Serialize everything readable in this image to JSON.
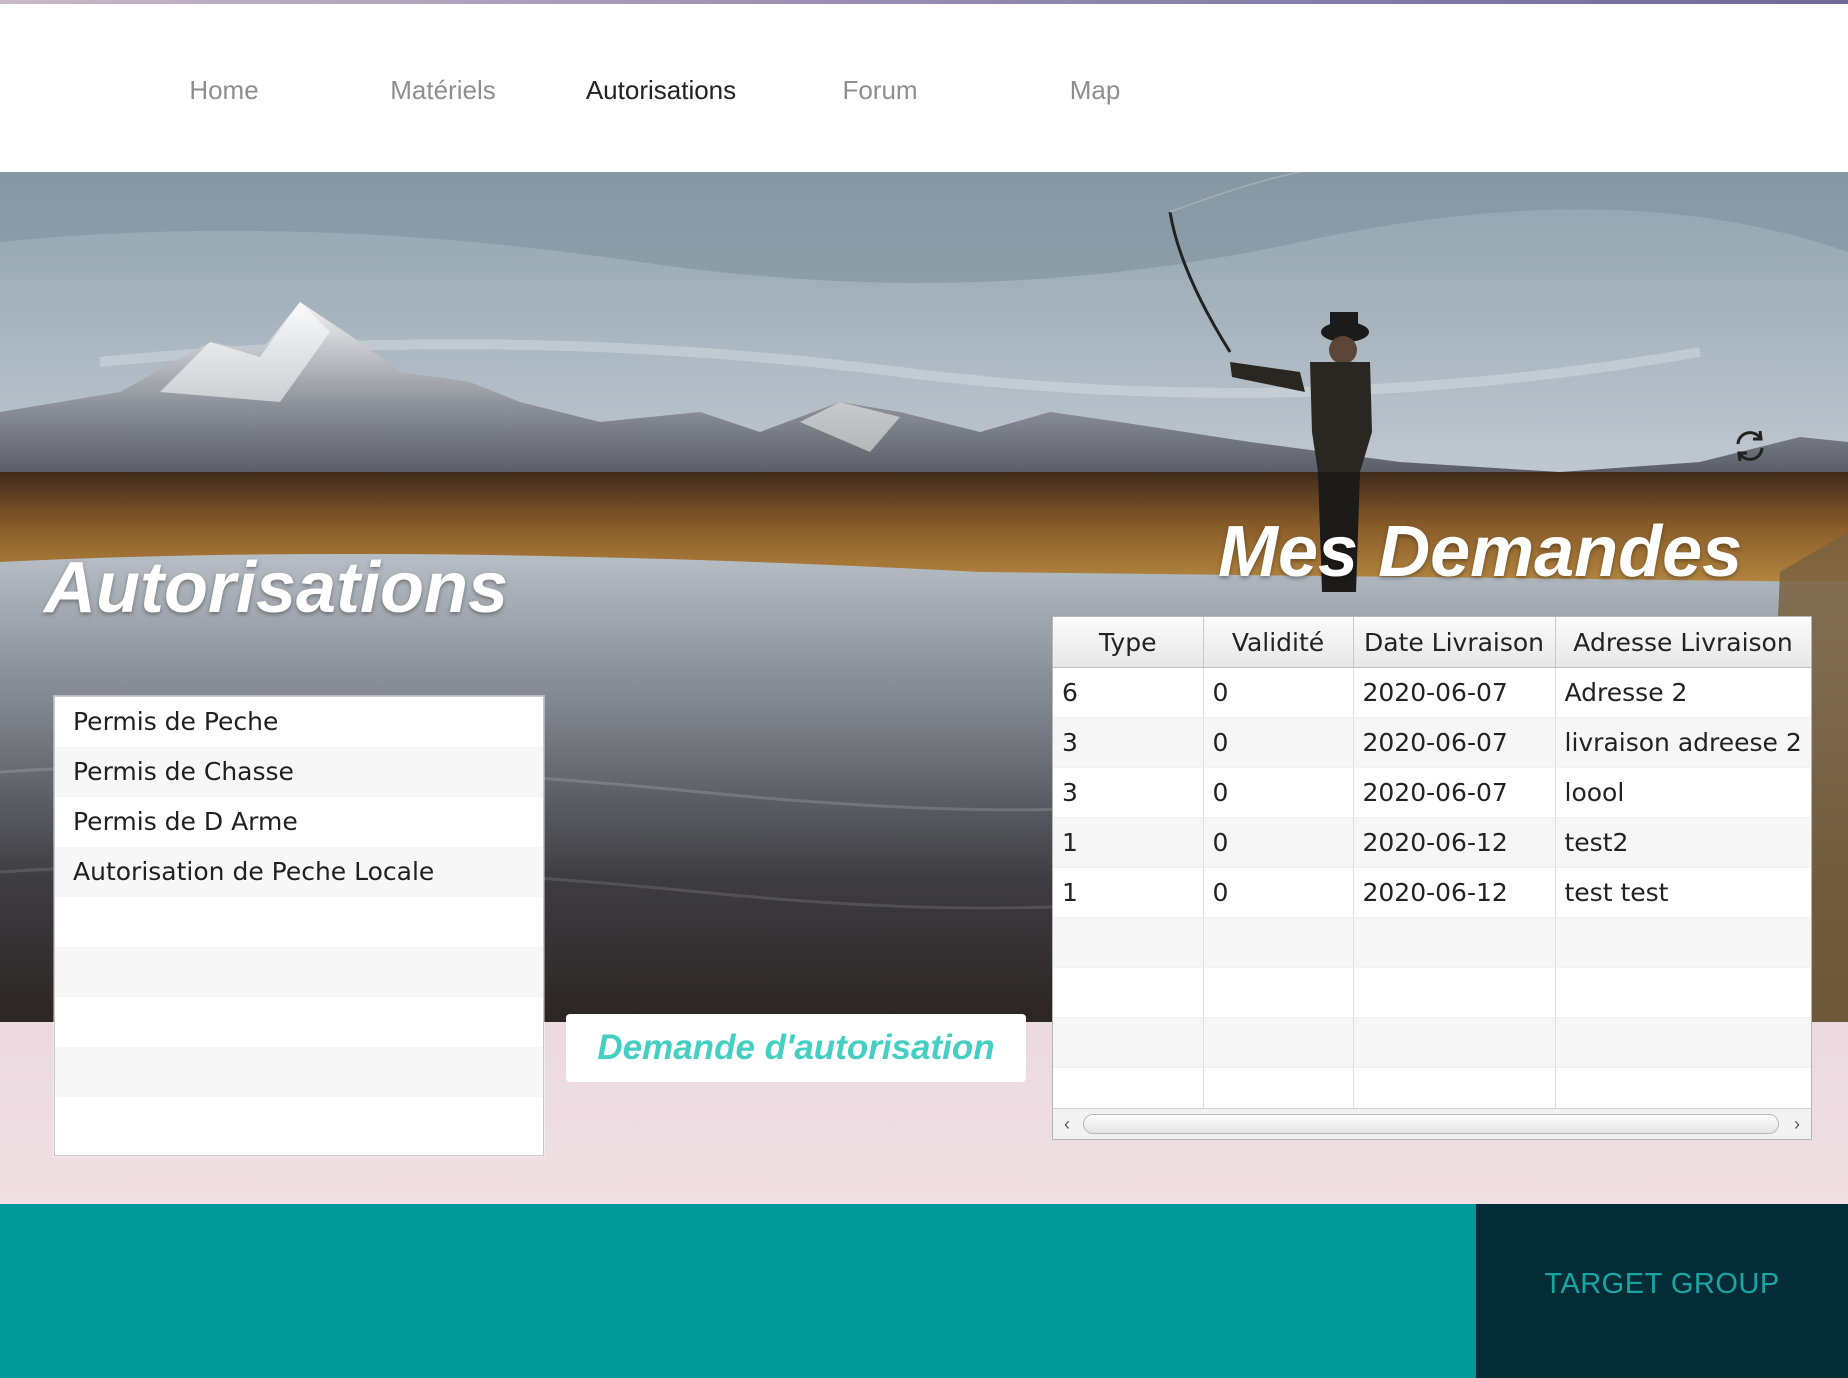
{
  "nav": {
    "items": [
      {
        "label": "Home",
        "active": false
      },
      {
        "label": "Matériels",
        "active": false
      },
      {
        "label": "Autorisations",
        "active": true
      },
      {
        "label": "Forum",
        "active": false
      },
      {
        "label": "Map",
        "active": false
      }
    ]
  },
  "permits": {
    "title": "Autorisations",
    "items": [
      "Permis de Peche",
      "Permis de Chasse",
      "Permis de D Arme",
      "Autorisation de Peche Locale"
    ]
  },
  "request_button": {
    "label": "Demande d'autorisation"
  },
  "requests": {
    "title": "Mes Demandes",
    "columns": [
      "Type",
      "Validité",
      "Date Livraison",
      "Adresse Livraison"
    ],
    "rows": [
      [
        "6",
        "0",
        "2020-06-07",
        "Adresse 2"
      ],
      [
        "3",
        "0",
        "2020-06-07",
        "livraison adreese 2"
      ],
      [
        "3",
        "0",
        "2020-06-07",
        "loool"
      ],
      [
        "1",
        "0",
        "2020-06-12",
        "test2"
      ],
      [
        "1",
        "0",
        "2020-06-12",
        "test test"
      ]
    ],
    "scroll_left_icon": "chevron-left-icon",
    "scroll_right_icon": "chevron-right-icon"
  },
  "refresh": {
    "icon": "refresh-icon"
  },
  "footer": {
    "brand": "TARGET GROUP",
    "colors": {
      "band": "#009999",
      "brand_block": "#042c37",
      "brand_text": "#1aa5a5"
    }
  },
  "colors": {
    "button_text": "#45cfc2",
    "nav_active": "#222222",
    "nav_inactive": "#8e8e8e"
  }
}
